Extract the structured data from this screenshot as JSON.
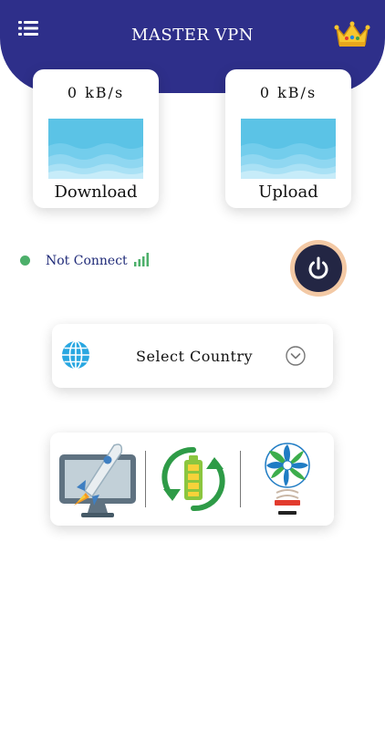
{
  "header": {
    "title": "MASTER VPN",
    "menu_icon": "menu-list-icon",
    "premium_icon": "crown-icon",
    "background_color": "#2e2f8a"
  },
  "speed": {
    "download": {
      "value": "0  kB/s",
      "label": "Download"
    },
    "upload": {
      "value": "0  kB/s",
      "label": "Upload"
    }
  },
  "connection": {
    "status": "Not Connect",
    "status_color": "#4caf6a",
    "power_icon": "power-icon"
  },
  "country": {
    "label": "Select Country",
    "icon": "globe-icon",
    "dropdown_icon": "chevron-down-icon"
  },
  "tools": [
    {
      "name": "phone-booster",
      "icon": "rocket-monitor-icon"
    },
    {
      "name": "battery-saver",
      "icon": "battery-recycle-icon"
    },
    {
      "name": "cpu-cooler",
      "icon": "cooling-fan-icon"
    }
  ]
}
